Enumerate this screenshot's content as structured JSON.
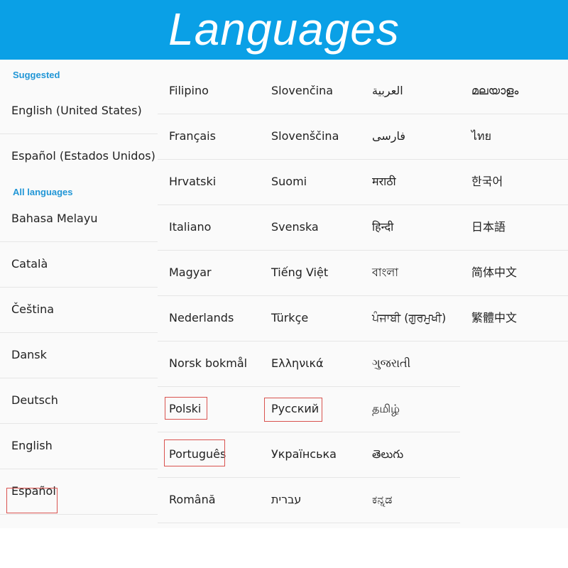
{
  "header": {
    "title": "Languages"
  },
  "sections": {
    "suggested": "Suggested",
    "all": "All languages"
  },
  "suggested": [
    "English (United States)",
    "Español (Estados Unidos)"
  ],
  "columns": [
    [
      "Bahasa Melayu",
      "Català",
      "Čeština",
      "Dansk",
      "Deutsch",
      "English",
      "Español"
    ],
    [
      "Filipino",
      "Français",
      "Hrvatski",
      "Italiano",
      "Magyar",
      "Nederlands",
      "Norsk bokmål",
      "Polski",
      "Português",
      "Română"
    ],
    [
      "Slovenčina",
      "Slovenščina",
      "Suomi",
      "Svenska",
      "Tiếng Việt",
      "Türkçe",
      "Ελληνικά",
      "Русский",
      "Українська",
      "עברית"
    ],
    [
      "العربية",
      "فارسی",
      "मराठी",
      "हिन्दी",
      "বাংলা",
      "ਪੰਜਾਬੀ (ਗੁਰਮੁਖੀ)",
      "ગુજરાતી",
      "தமிழ்",
      "తెలుగు",
      "ಕನ್ನಡ"
    ],
    [
      "മലയാളം",
      "ไทย",
      "한국어",
      "日本語",
      "简体中文",
      "繁體中文"
    ]
  ],
  "highlight_color": "#d9534f",
  "accent_color": "#0aa0e6"
}
